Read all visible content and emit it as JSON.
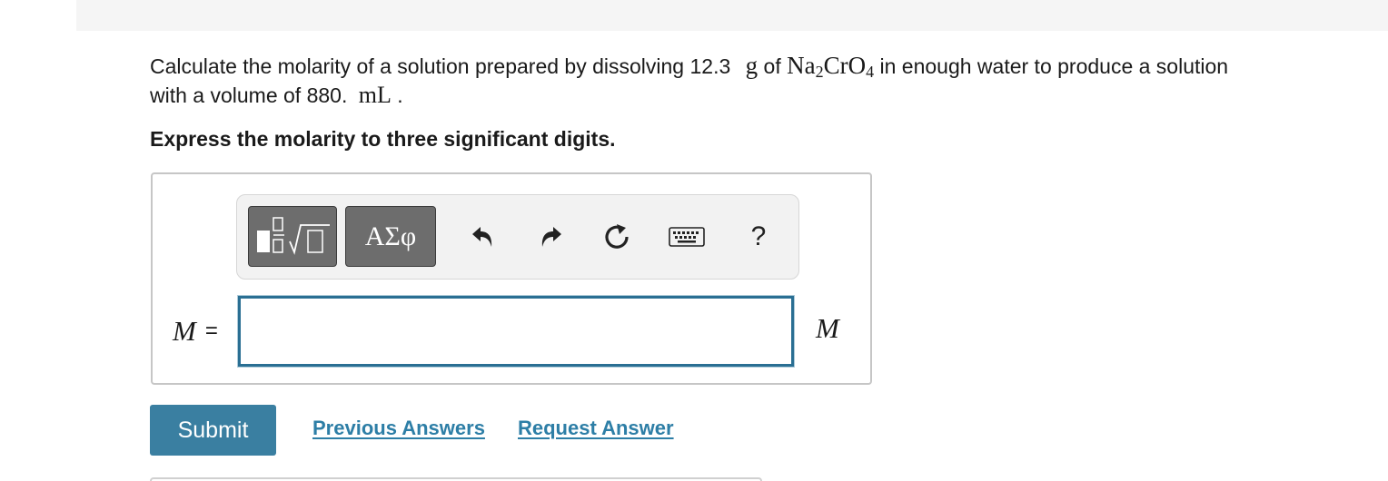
{
  "question": {
    "text_before": "Calculate the molarity of a solution prepared by dissolving 12.3",
    "mass_unit": "g",
    "of_word": "of",
    "formula_na": "Na",
    "formula_na_sub": "2",
    "formula_cro": "CrO",
    "formula_cro_sub": "4",
    "text_after": "in enough water to produce a solution",
    "line2_prefix": "with a volume of 880.",
    "volume_unit": "mL",
    "period": "."
  },
  "instruction": "Express the molarity to three significant digits.",
  "toolbar": {
    "templates_icon": "fraction-sqrt-template-icon",
    "symbols_label": "ΑΣφ",
    "undo_icon": "undo-arrow-icon",
    "redo_icon": "redo-arrow-icon",
    "reset_icon": "reset-circle-arrow-icon",
    "keyboard_icon": "keyboard-icon",
    "help_label": "?"
  },
  "answer": {
    "variable": "M",
    "equals": "=",
    "value": "",
    "unit": "M"
  },
  "actions": {
    "submit_label": "Submit",
    "previous_answers_label": "Previous Answers",
    "request_answer_label": "Request Answer"
  },
  "colors": {
    "submit_bg": "#3a7fa1",
    "link": "#2d7ea6",
    "input_border": "#2a6f93",
    "toolbar_button": "#6d6d6d"
  }
}
